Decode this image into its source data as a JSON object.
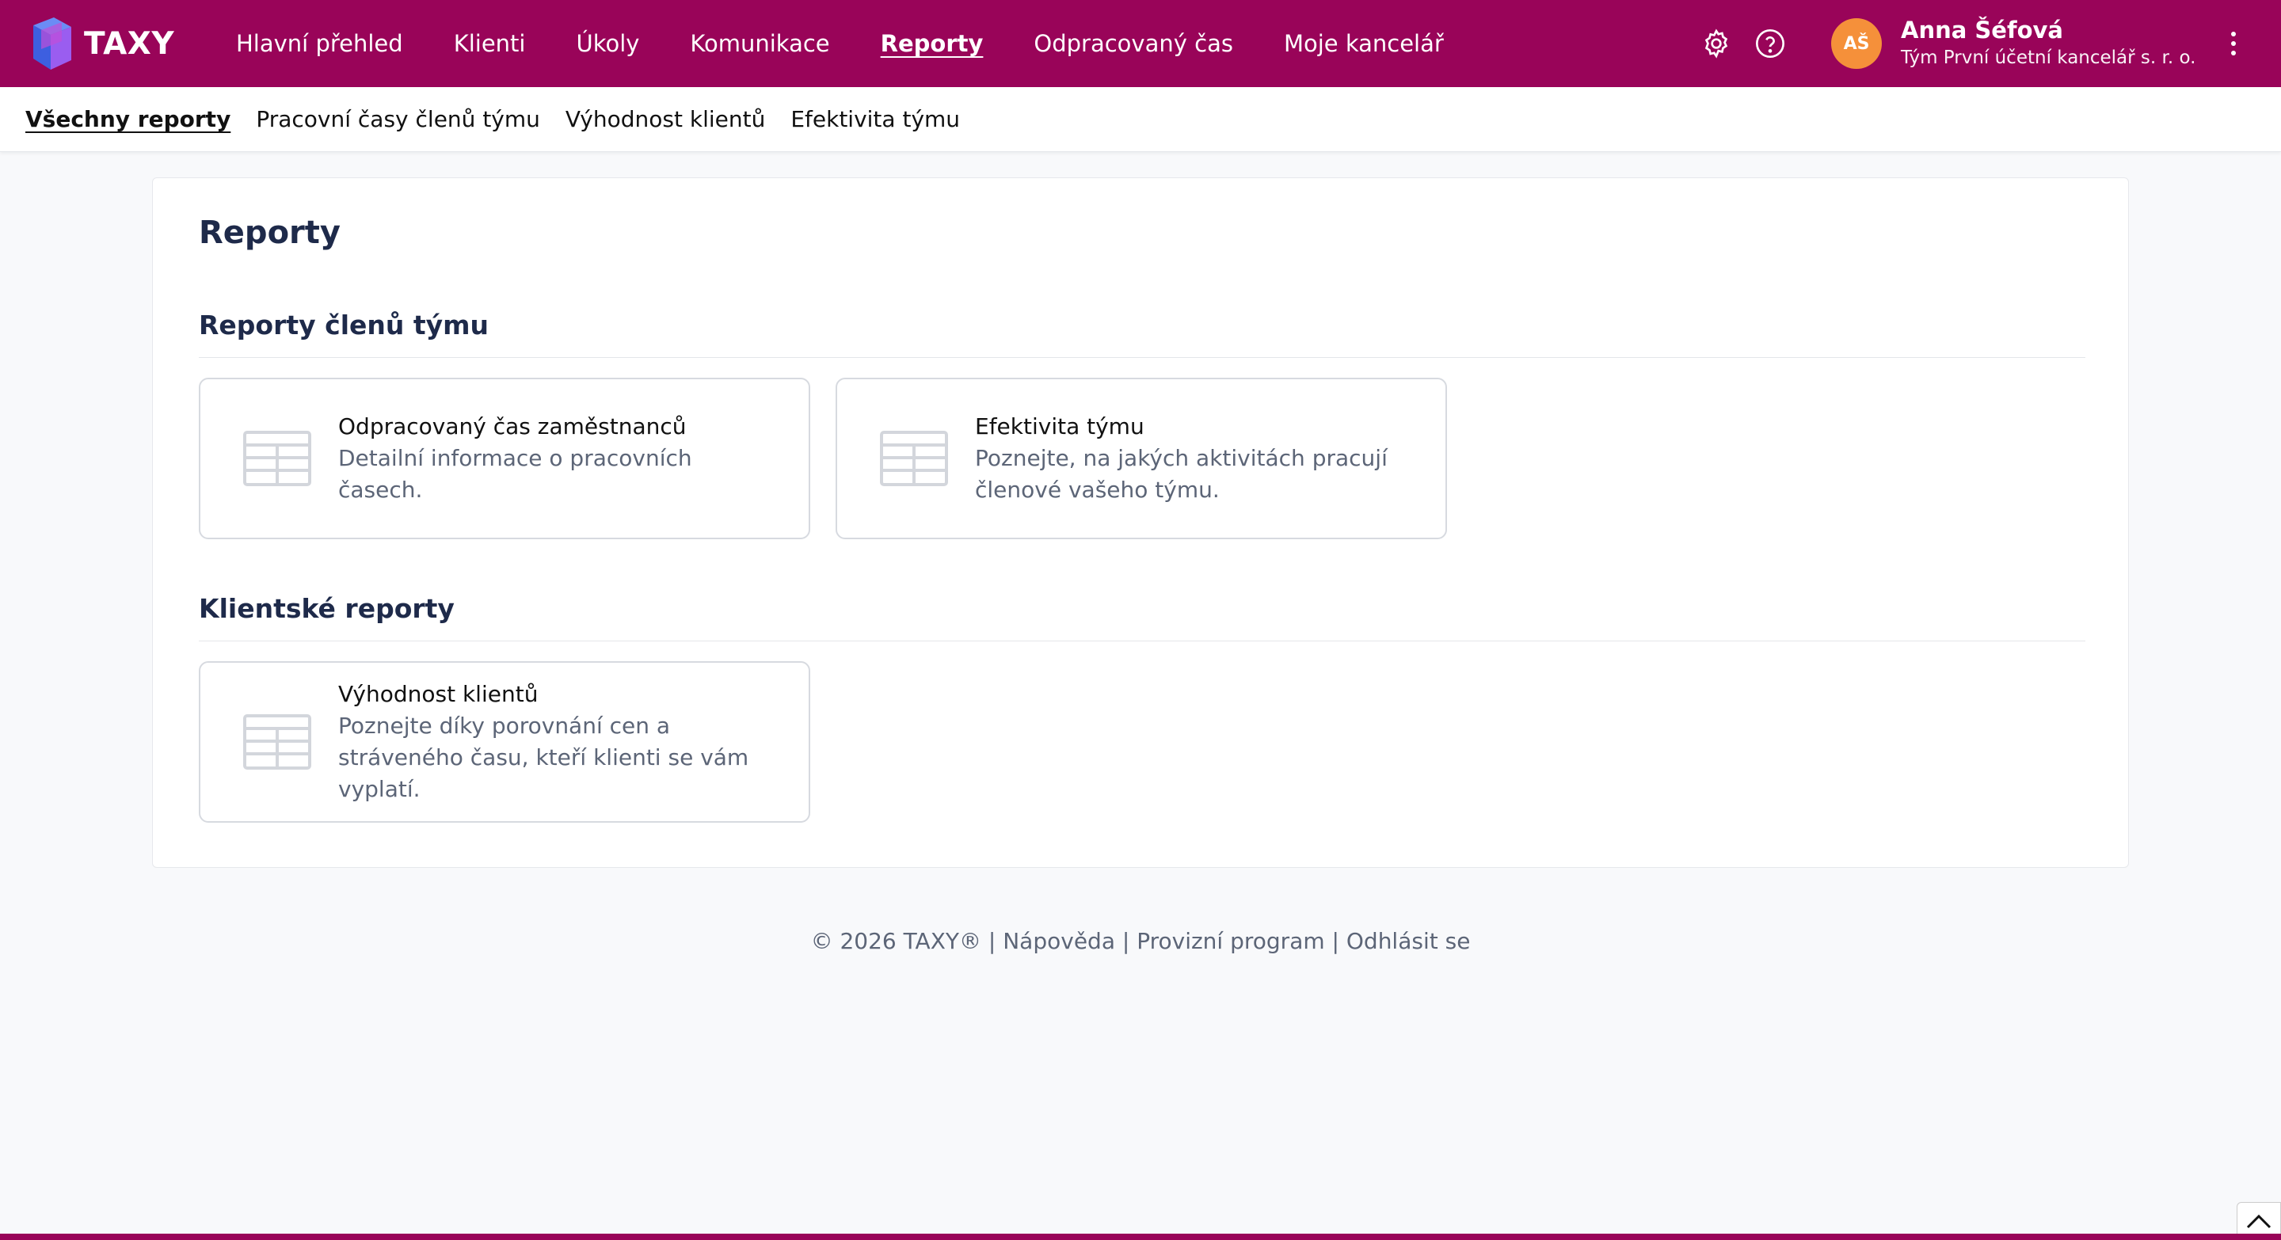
{
  "app": {
    "logo_text": "TAXY"
  },
  "mainnav": {
    "items": [
      {
        "label": "Hlavní přehled",
        "active": false
      },
      {
        "label": "Klienti",
        "active": false
      },
      {
        "label": "Úkoly",
        "active": false
      },
      {
        "label": "Komunikace",
        "active": false
      },
      {
        "label": "Reporty",
        "active": true
      },
      {
        "label": "Odpracovaný čas",
        "active": false
      },
      {
        "label": "Moje kancelář",
        "active": false
      }
    ]
  },
  "user": {
    "initials": "AŠ",
    "name": "Anna Šéfová",
    "team": "Tým První účetní kancelář s. r. o."
  },
  "subnav": {
    "items": [
      {
        "label": "Všechny reporty",
        "active": true
      },
      {
        "label": "Pracovní časy členů týmu",
        "active": false
      },
      {
        "label": "Výhodnost klientů",
        "active": false
      },
      {
        "label": "Efektivita týmu",
        "active": false
      }
    ]
  },
  "main": {
    "title": "Reporty",
    "sections": [
      {
        "title": "Reporty členů týmu",
        "cards": [
          {
            "title": "Odpracovaný čas zaměstnanců",
            "description": "Detailní informace o pracovních časech."
          },
          {
            "title": "Efektivita týmu",
            "description": "Poznejte, na jakých aktivitách pracují členové vašeho týmu."
          }
        ]
      },
      {
        "title": "Klientské reporty",
        "cards": [
          {
            "title": "Výhodnost klientů",
            "description": "Poznejte díky porovnání cen a stráveného času, kteří klienti se vám vyplatí."
          }
        ]
      }
    ]
  },
  "footer": {
    "copyright": "© 2026 TAXY®",
    "separator": " | ",
    "help": "Nápověda",
    "affiliate": "Provizní program",
    "logout": "Odhlásit se"
  },
  "colors": {
    "brand": "#990459",
    "avatar": "#f5903a",
    "heading": "#1e2a4a"
  },
  "icons": [
    "taxy-logo-icon",
    "gear-icon",
    "help-icon",
    "kebab-menu-icon",
    "table-icon",
    "chevron-up-icon"
  ]
}
